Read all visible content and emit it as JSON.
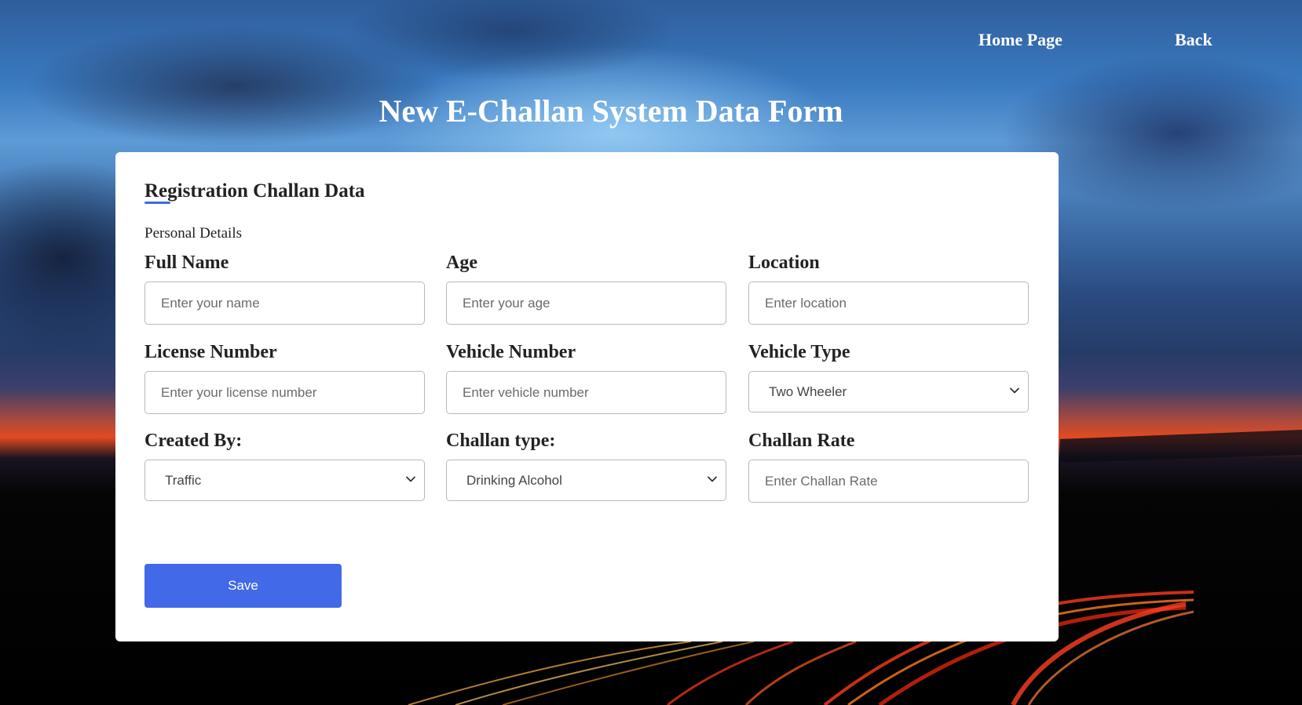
{
  "nav": {
    "home_label": "Home Page",
    "back_label": "Back"
  },
  "page": {
    "title": "New E-Challan System Data Form"
  },
  "form": {
    "title": "Registration Challan Data",
    "section_label": "Personal Details",
    "fields": {
      "full_name": {
        "label": "Full Name",
        "placeholder": "Enter your name",
        "value": ""
      },
      "age": {
        "label": "Age",
        "placeholder": "Enter your age",
        "value": ""
      },
      "location": {
        "label": "Location",
        "placeholder": "Enter location",
        "value": ""
      },
      "license_number": {
        "label": "License Number",
        "placeholder": "Enter your license number",
        "value": ""
      },
      "vehicle_number": {
        "label": "Vehicle Number",
        "placeholder": "Enter vehicle number",
        "value": ""
      },
      "vehicle_type": {
        "label": "Vehicle Type",
        "selected": "Two Wheeler"
      },
      "created_by": {
        "label": "Created By:",
        "selected": "Traffic"
      },
      "challan_type": {
        "label": "Challan type:",
        "selected": "Drinking Alcohol"
      },
      "challan_rate": {
        "label": "Challan Rate",
        "placeholder": "Enter Challan Rate",
        "value": ""
      }
    },
    "save_label": "Save"
  },
  "colors": {
    "accent": "#4169e8",
    "card_background": "#ffffff",
    "input_border": "#b9b9b9"
  },
  "icons": {
    "select_chevron": "chevron-down-icon"
  }
}
